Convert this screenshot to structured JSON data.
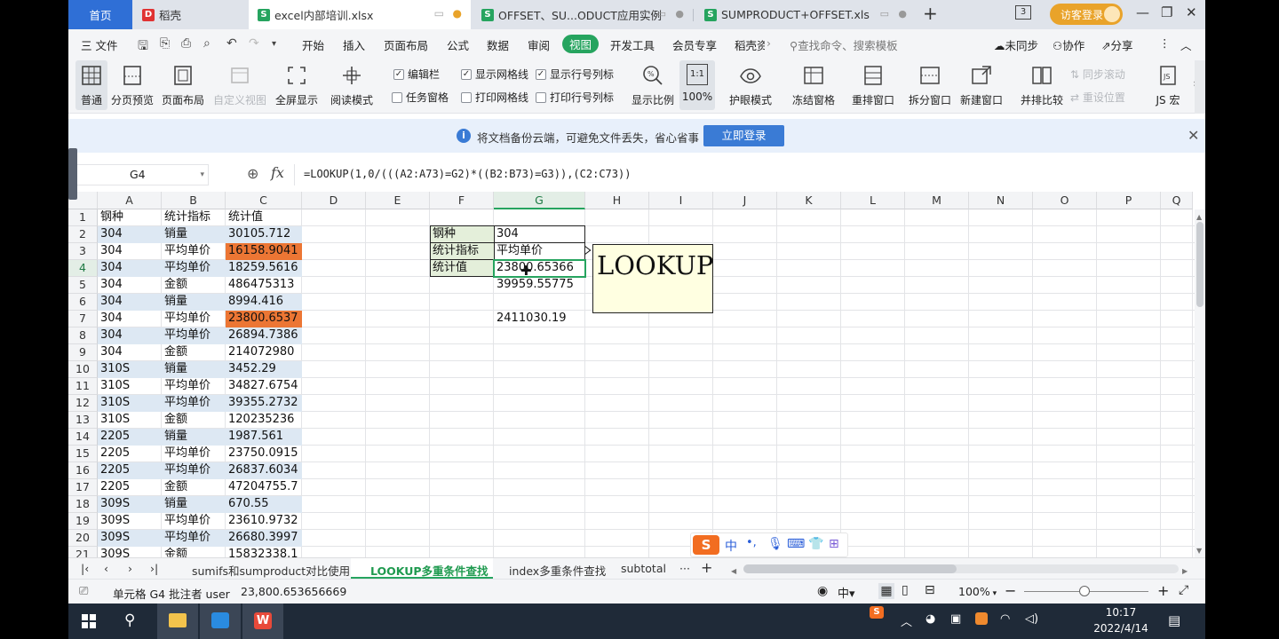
{
  "tabs": {
    "home": "首页",
    "daoke": "稻壳",
    "file1": "excel内部培训.xlsx",
    "file2": "OFFSET、SU...ODUCT应用实例",
    "file3": "SUMPRODUCT+OFFSET.xls",
    "add": "+",
    "visitor": "访客登录"
  },
  "menubar": {
    "file": "三 文件",
    "items": [
      "开始",
      "插入",
      "页面布局",
      "公式",
      "数据",
      "审阅",
      "视图",
      "开发工具",
      "会员专享",
      "稻壳资"
    ],
    "selected": "视图",
    "search": "查找命令、搜索模板",
    "sync": "未同步",
    "collab": "协作",
    "share": "分享"
  },
  "ribbon": {
    "normal": "普通",
    "pagebreak": "分页预览",
    "pagelayout": "页面布局",
    "customview": "自定义视图",
    "fullscreen": "全屏显示",
    "reading": "阅读模式",
    "chk_formulabar": "编辑栏",
    "chk_gridlines": "显示网格线",
    "chk_headers": "显示行号列标",
    "chk_taskpane": "任务窗格",
    "chk_printgrid": "打印网格线",
    "chk_printheaders": "打印行号列标",
    "zoom": "显示比例",
    "zoom100": "100%",
    "eyecare": "护眼模式",
    "freeze": "冻结窗格",
    "arrange": "重排窗口",
    "split": "拆分窗口",
    "newwin": "新建窗口",
    "sidebyside": "并排比较",
    "syncscroll": "同步滚动",
    "resetpos": "重设位置",
    "macro": "JS 宏",
    "zoom_icon": "1:1"
  },
  "banner": {
    "text": "将文档备份云端，可避免文件丢失，省心省事",
    "button": "立即登录"
  },
  "formula": {
    "namebox": "G4",
    "fx": "fx",
    "text": "=LOOKUP(1,0/(((A2:A73)=G2)*((B2:B73)=G3)),(C2:C73))"
  },
  "columns": [
    "A",
    "B",
    "C",
    "D",
    "E",
    "F",
    "G",
    "H",
    "I",
    "J",
    "K",
    "L",
    "M",
    "N",
    "O",
    "P",
    "Q"
  ],
  "rows": [
    {
      "n": "1",
      "a": "钢种",
      "b": "统计指标",
      "c": "统计值"
    },
    {
      "n": "2",
      "a": "304",
      "b": "销量",
      "c": "30105.712"
    },
    {
      "n": "3",
      "a": "304",
      "b": "平均单价",
      "c": "16158.9041"
    },
    {
      "n": "4",
      "a": "304",
      "b": "平均单价",
      "c": "18259.5616"
    },
    {
      "n": "5",
      "a": "304",
      "b": "金额",
      "c": "486475313"
    },
    {
      "n": "6",
      "a": "304",
      "b": "销量",
      "c": "8994.416"
    },
    {
      "n": "7",
      "a": "304",
      "b": "平均单价",
      "c": "23800.6537"
    },
    {
      "n": "8",
      "a": "304",
      "b": "平均单价",
      "c": "26894.7386"
    },
    {
      "n": "9",
      "a": "304",
      "b": "金额",
      "c": "214072980"
    },
    {
      "n": "10",
      "a": "310S",
      "b": "销量",
      "c": "3452.29"
    },
    {
      "n": "11",
      "a": "310S",
      "b": "平均单价",
      "c": "34827.6754"
    },
    {
      "n": "12",
      "a": "310S",
      "b": "平均单价",
      "c": "39355.2732"
    },
    {
      "n": "13",
      "a": "310S",
      "b": "金额",
      "c": "120235236"
    },
    {
      "n": "14",
      "a": "2205",
      "b": "销量",
      "c": "1987.561"
    },
    {
      "n": "15",
      "a": "2205",
      "b": "平均单价",
      "c": "23750.0915"
    },
    {
      "n": "16",
      "a": "2205",
      "b": "平均单价",
      "c": "26837.6034"
    },
    {
      "n": "17",
      "a": "2205",
      "b": "金额",
      "c": "47204755.7"
    },
    {
      "n": "18",
      "a": "309S",
      "b": "销量",
      "c": "670.55"
    },
    {
      "n": "19",
      "a": "309S",
      "b": "平均单价",
      "c": "23610.9732"
    },
    {
      "n": "20",
      "a": "309S",
      "b": "平均单价",
      "c": "26680.3997"
    },
    {
      "n": "21",
      "a": "309S",
      "b": "金额",
      "c": "15832338.1"
    }
  ],
  "lookup_table": {
    "f2": "钢种",
    "g2": "304",
    "f3": "统计指标",
    "g3": "平均单价",
    "f4": "统计值",
    "g4": "23800.65366",
    "g5": "39959.55775",
    "g7": "2411030.19"
  },
  "textbox": "LOOKUP",
  "sheets": [
    "sumifs和sumproduct对比使用",
    "LOOKUP多重条件查找",
    "index多重条件查找",
    "subtotal"
  ],
  "active_sheet": "LOOKUP多重条件查找",
  "status": {
    "comment": "单元格 G4 批注者 user",
    "value": "23,800.653656669",
    "zoom": "100%"
  },
  "taskbar": {
    "time": "10:17",
    "date": "2022/4/14"
  },
  "colors": {
    "accent": "#26a45f",
    "highlight": "#dde8f3",
    "orange": "#ec7634",
    "label_fill": "#e4efda",
    "textbox_fill": "#ffffe1"
  }
}
